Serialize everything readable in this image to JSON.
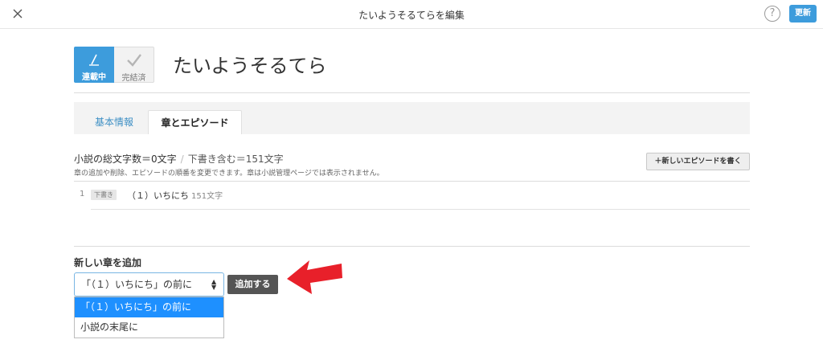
{
  "topbar": {
    "title": "たいようそるてらを編集",
    "help_label": "?",
    "update_label": "更新",
    "close_icon": "close-icon"
  },
  "status": {
    "ongoing_label": "連載中",
    "complete_label": "完結済",
    "active_color": "#3d9cdc"
  },
  "novel": {
    "title": "たいようそるてら"
  },
  "tabs": [
    {
      "label": "基本情報",
      "active": false
    },
    {
      "label": "章とエピソード",
      "active": true
    }
  ],
  "stats": {
    "total_chars": "小説の総文字数＝0文字",
    "separator": "/",
    "including_drafts": "下書き含む＝151文字",
    "note": "章の追加や削除、エピソードの順番を変更できます。章は小説管理ページでは表示されません。"
  },
  "new_episode_button": "＋新しいエピソードを書く",
  "episodes": [
    {
      "number": "1",
      "badge": "下書き",
      "title": "（１）いちにち",
      "char_count": "151文字"
    }
  ],
  "add_chapter": {
    "heading": "新しい章を追加",
    "selected_value": "「（１）いちにち」の前に",
    "button_label": "追加する",
    "options": [
      "「（１）いちにち」の前に",
      "小説の末尾に"
    ],
    "highlight_color": "#1e90ff",
    "arrow_color": "#e8202a"
  }
}
